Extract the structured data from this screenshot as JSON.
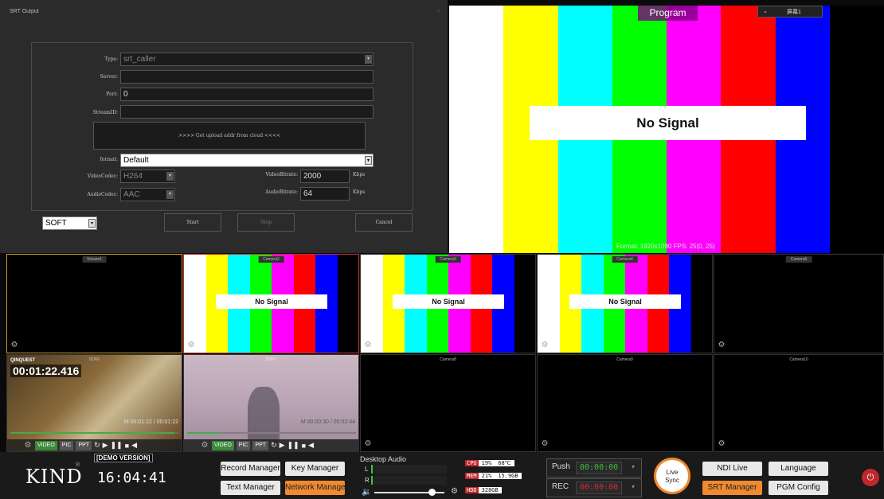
{
  "srt": {
    "title": "SRT Output",
    "close": "×",
    "type_label": "Type:",
    "type_value": "srt_caller",
    "server_label": "Server:",
    "port_label": "Port:",
    "port_value": "0",
    "streamid_label": "StreamID:",
    "cloud_text": ">>>> Get upload addr from cloud <<<<",
    "format_label": "format:",
    "format_value": "Default",
    "videocodec_label": "VideoCodec:",
    "videocodec_value": "H264",
    "audiocodec_label": "AudioCodec:",
    "audiocodec_value": "AAC",
    "videobitrate_label": "VideoBitrate:",
    "videobitrate_value": "2000",
    "audiobitrate_label": "AudioBitrate:",
    "audiobitrate_value": "64",
    "unit": "Kbps",
    "encoder_value": "SOFT",
    "start": "Start",
    "stop": "Stop",
    "cancel": "Cancel"
  },
  "program": {
    "title": "Program",
    "screen": "屏幕1",
    "no_signal": "No Signal",
    "format": "Format: 1920x1080 FPS: 25(0, 25)",
    "bar_colors": [
      "#ffffff",
      "#ffff00",
      "#00ffff",
      "#00ff00",
      "#ff00ff",
      "#ff0000",
      "#0000ff",
      "#000000"
    ]
  },
  "tiles_row1": [
    {
      "label": "Stream1",
      "signal": false
    },
    {
      "label": "Camera2",
      "signal": true,
      "no_signal": "No Signal"
    },
    {
      "label": "Camera3",
      "signal": true,
      "no_signal": "No Signal"
    },
    {
      "label": "Camera4",
      "signal": true,
      "no_signal": "No Signal"
    },
    {
      "label": "Camera5",
      "signal": false
    }
  ],
  "ddr6": {
    "label": "DDR6",
    "timecode": "00:01:22.416",
    "progress": "M 00:01:22 / 00:01:22",
    "watermark": "QINQUEST",
    "video": "VIDEO",
    "pic": "PIC",
    "ppt": "PPT"
  },
  "ddr7": {
    "label": "DDR7",
    "progress": "M 00:00:30 / 00:02:44",
    "video": "VIDEO",
    "pic": "PIC",
    "ppt": "PPT"
  },
  "tiles_row2": [
    {
      "label": "Camera8"
    },
    {
      "label": "Camera9"
    },
    {
      "label": "Camera10"
    }
  ],
  "bottom": {
    "logo": "KIND",
    "reg": "®",
    "demo": "[DEMO VERSION]",
    "clock": "16:04:41",
    "record_manager": "Record Manager",
    "key_manager": "Key Manager",
    "text_manager": "Text Manager",
    "network_manager": "Network Manage",
    "desktop_audio": "Desktop Audio",
    "ch_l": "L",
    "ch_r": "R",
    "cpu_k": "CPU",
    "cpu_v": "19%",
    "temp": "68℃",
    "mem_k": "MEM",
    "mem_v": "21%",
    "mem_size": "15.9GB",
    "hdd_k": "HDD",
    "hdd_v": "328GB",
    "push": "Push",
    "push_time": "00:00:00",
    "rec": "REC",
    "rec_time": "00:00:00",
    "live": "Live",
    "sync": "Sync",
    "ndi_live": "NDI Live",
    "language": "Language",
    "srt_manager": "SRT Manager",
    "pgm_config": "PGM Config"
  },
  "colors": {
    "accent_orange": "#f08a30",
    "stat_red": "#c0272d",
    "timer_green": "#3fbf3f",
    "timer_red": "#d03030"
  }
}
